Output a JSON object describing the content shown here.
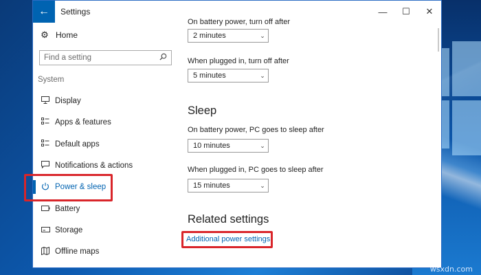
{
  "window": {
    "title": "Settings",
    "back_icon": "←",
    "controls": [
      {
        "name": "minimize-button",
        "icon": "—"
      },
      {
        "name": "maximize-button",
        "icon": "☐"
      },
      {
        "name": "close-button",
        "icon": "✕"
      }
    ]
  },
  "sidebar": {
    "home_label": "Home",
    "search_placeholder": "Find a setting",
    "section_label": "System",
    "items": [
      {
        "label": "Display",
        "icon": "display-icon"
      },
      {
        "label": "Apps & features",
        "icon": "apps-icon"
      },
      {
        "label": "Default apps",
        "icon": "default-apps-icon"
      },
      {
        "label": "Notifications & actions",
        "icon": "notifications-icon"
      },
      {
        "label": "Power & sleep",
        "icon": "power-icon",
        "active": true
      },
      {
        "label": "Battery",
        "icon": "battery-icon"
      },
      {
        "label": "Storage",
        "icon": "storage-icon"
      },
      {
        "label": "Offline maps",
        "icon": "map-icon"
      }
    ]
  },
  "screen": {
    "battery_label": "On battery power, turn off after",
    "battery_value": "2 minutes",
    "plugged_label": "When plugged in, turn off after",
    "plugged_value": "5 minutes"
  },
  "sleep": {
    "heading": "Sleep",
    "battery_label": "On battery power, PC goes to sleep after",
    "battery_value": "10 minutes",
    "plugged_label": "When plugged in, PC goes to sleep after",
    "plugged_value": "15 minutes"
  },
  "related": {
    "heading": "Related settings",
    "link": "Additional power settings"
  },
  "watermark": "wsxdn.com",
  "colors": {
    "accent": "#0063b1",
    "highlight": "#d9252a"
  }
}
